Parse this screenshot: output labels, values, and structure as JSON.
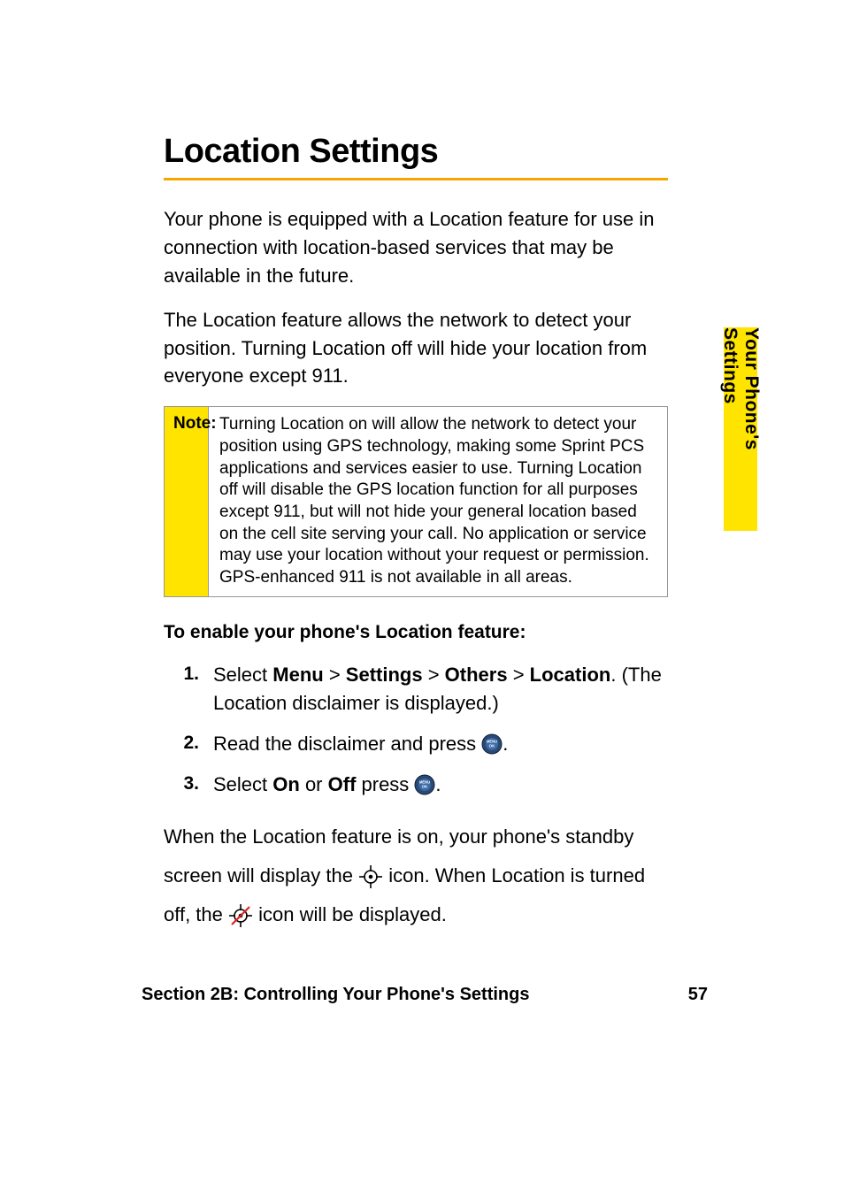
{
  "heading": "Location Settings",
  "intro_p1": "Your phone is equipped with a Location feature for use in connection with location-based services that may be available in the future.",
  "intro_p2": "The Location feature allows the network to detect your position. Turning Location off will hide your location from everyone except 911.",
  "note": {
    "label": "Note:",
    "text": "Turning Location on will allow the network to detect your position using GPS technology, making some Sprint PCS applications and services easier to use. Turning Location off will disable the GPS location function for all purposes except 911, but will not hide your general location based on the cell site serving your call. No application or service may use your location without your request or permission. GPS-enhanced 911 is not available in all areas."
  },
  "enable_heading": "To enable your phone's Location feature:",
  "steps": [
    {
      "num": "1.",
      "pre": "Select ",
      "menu": "Menu",
      "gt1": " > ",
      "settings": "Settings",
      "gt2": " > ",
      "others": "Others",
      "gt3": " > ",
      "location": "Location",
      "post": ". (The Location disclaimer is displayed.)"
    },
    {
      "num": "2.",
      "text_a": "Read the disclaimer and press ",
      "text_b": "."
    },
    {
      "num": "3.",
      "pre": "Select ",
      "on": "On",
      "or": " or ",
      "off": "Off",
      "press": " press ",
      "post": "."
    }
  ],
  "after": {
    "a": "When the Location feature is on, your phone's standby screen will display the ",
    "b": " icon. When Location is turned off, the ",
    "c": " icon will be displayed."
  },
  "side_tab": "Your Phone's Settings",
  "footer_left": "Section 2B: Controlling Your Phone's Settings",
  "footer_right": "57"
}
